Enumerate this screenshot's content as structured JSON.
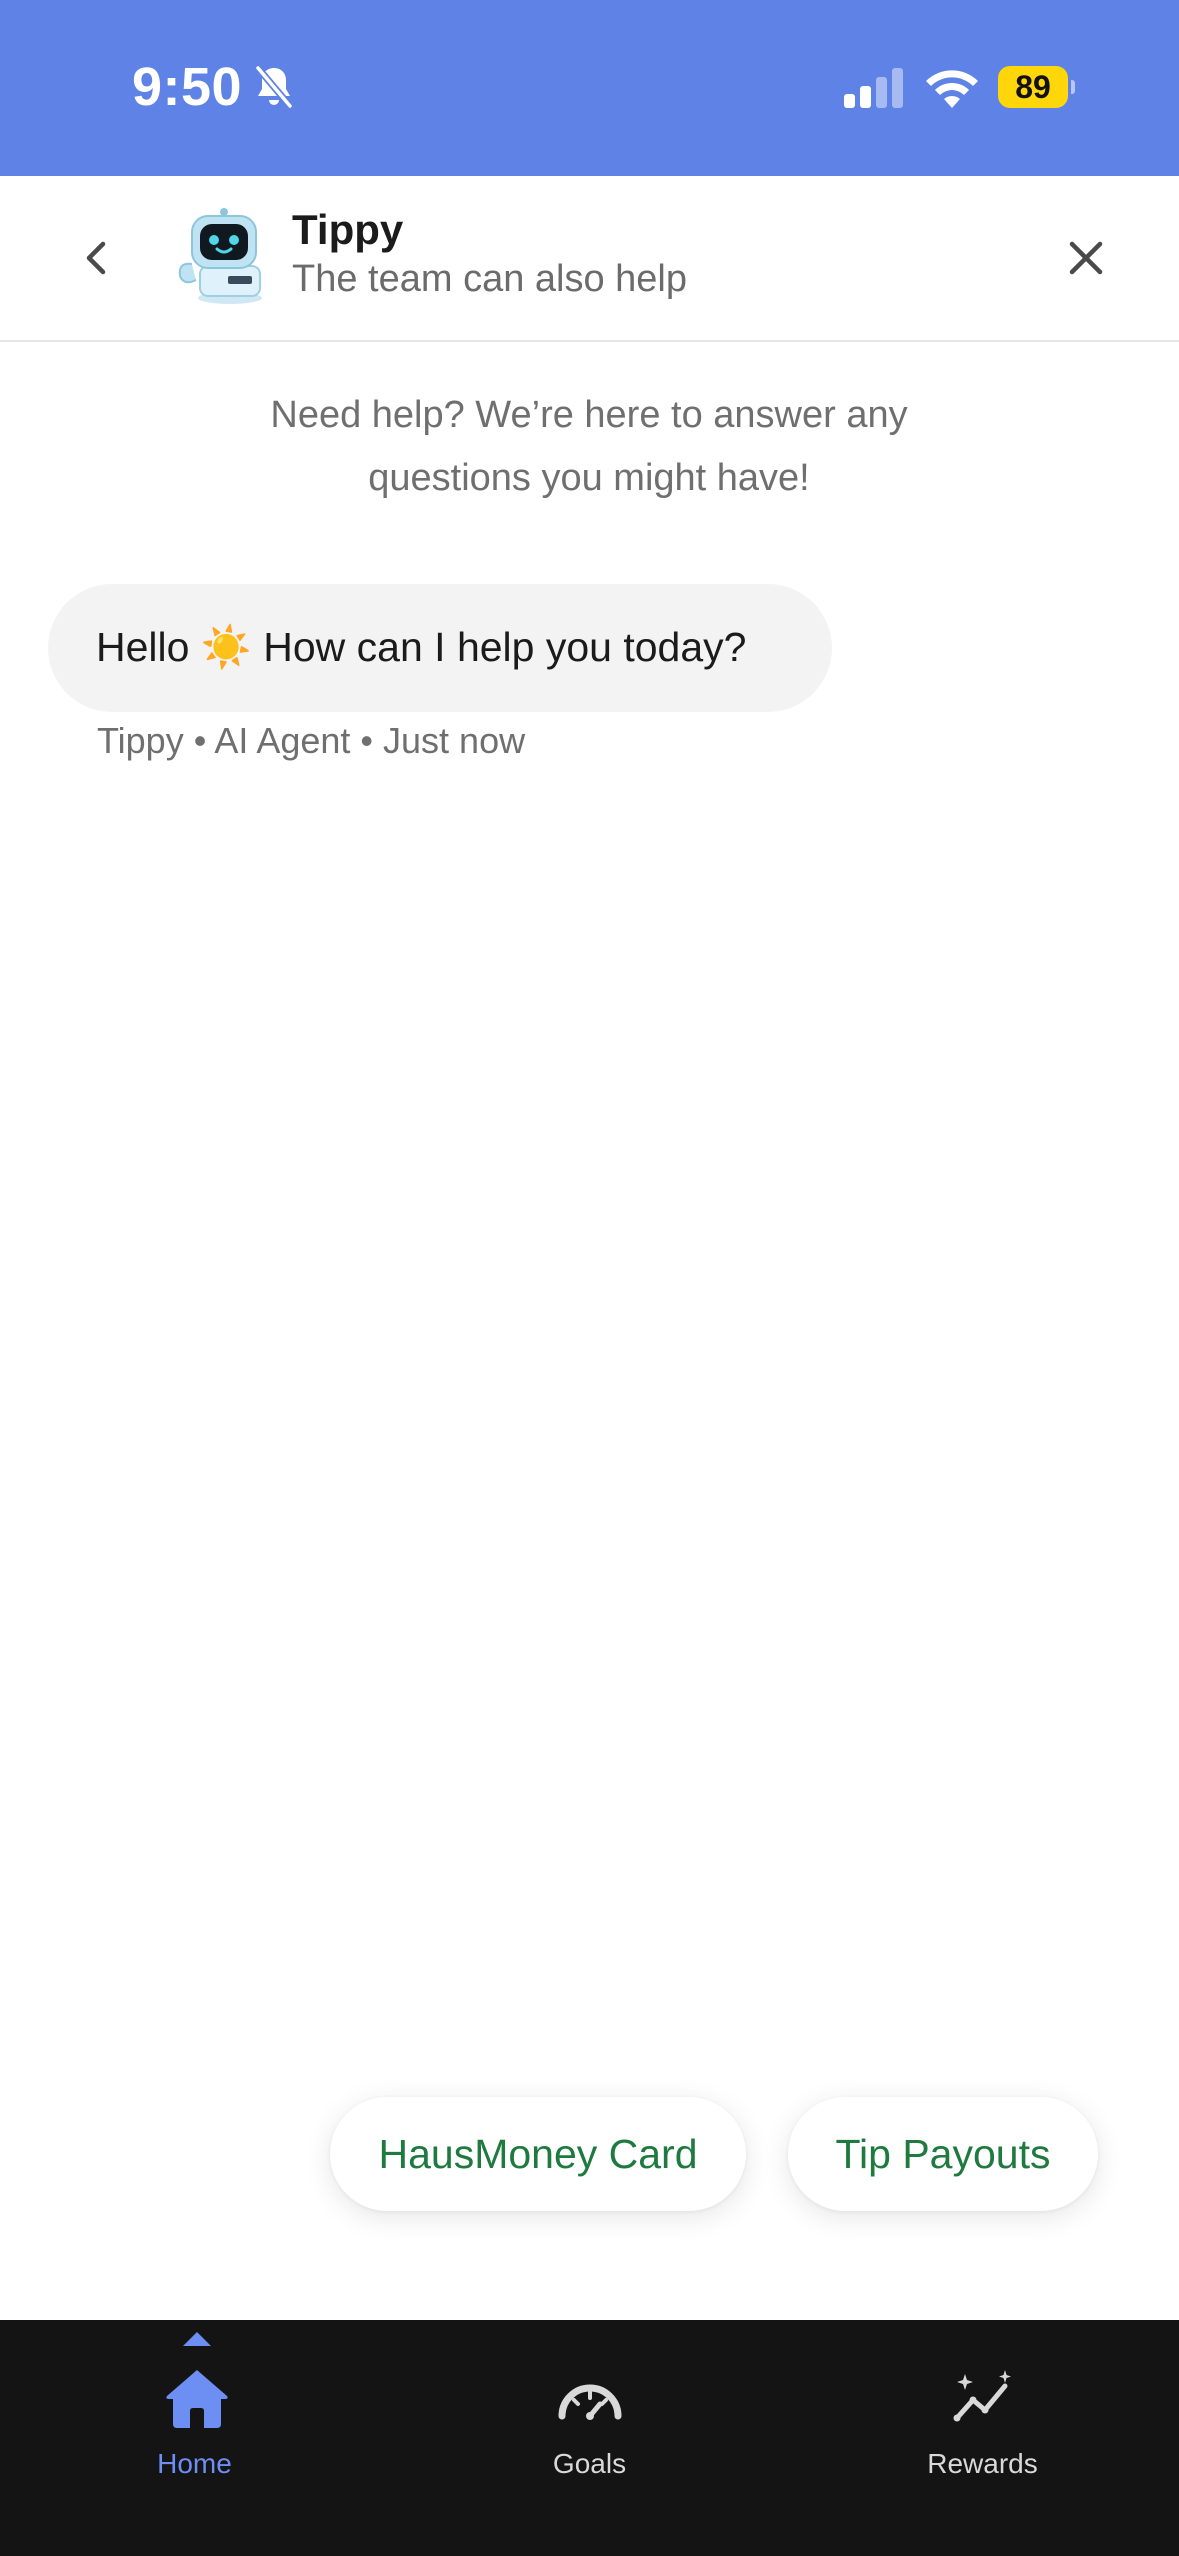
{
  "status_bar": {
    "time": "9:50",
    "battery_level": "89",
    "icons": [
      "bell-off-icon",
      "signal-icon",
      "wifi-icon",
      "battery-icon"
    ]
  },
  "header": {
    "agent_name": "Tippy",
    "subtitle": "The team can also help",
    "back_icon": "chevron-left-icon",
    "close_icon": "close-icon"
  },
  "intro": {
    "text": "Need help? We’re here to answer any questions you might have!"
  },
  "messages": [
    {
      "text": "Hello ☀️ How can I help you today?",
      "meta": "Tippy • AI Agent • Just now"
    }
  ],
  "quick_replies": [
    "HausMoney Card",
    "Tip Payouts"
  ],
  "nav": {
    "items": [
      {
        "label": "Home",
        "icon": "home-icon",
        "active": true
      },
      {
        "label": "Goals",
        "icon": "gauge-icon",
        "active": false
      },
      {
        "label": "Rewards",
        "icon": "sparkle-chart-icon",
        "active": false
      }
    ]
  },
  "colors": {
    "status_bar": "#5f82e6",
    "accent": "#6d8ef2",
    "chip_text": "#1e7a3f",
    "nav_background": "#141414"
  }
}
